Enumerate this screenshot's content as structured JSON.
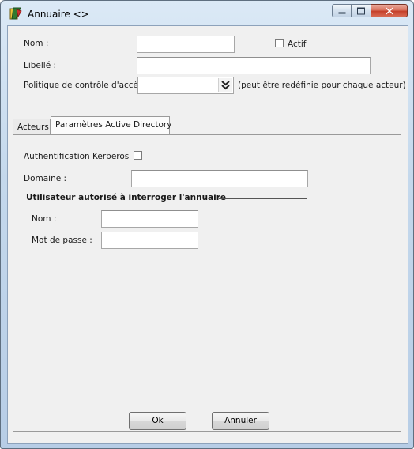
{
  "window": {
    "title": "Annuaire <>"
  },
  "form": {
    "nom_label": "Nom :",
    "nom_value": "",
    "actif_label": "Actif",
    "actif_checked": false,
    "libelle_label": "Libellé :",
    "libelle_value": "",
    "politique_label": "Politique de contrôle d'accès :",
    "politique_value": "",
    "politique_hint": "(peut être redéfinie pour chaque acteur)"
  },
  "tabs": [
    {
      "label": "Acteurs",
      "active": false
    },
    {
      "label": "Paramètres Active Directory",
      "active": true
    }
  ],
  "ad": {
    "kerberos_label": "Authentification Kerberos",
    "kerberos_checked": false,
    "domaine_label": "Domaine :",
    "domaine_value": "",
    "group_title": "Utilisateur autorisé à interroger l'annuaire",
    "user_nom_label": "Nom :",
    "user_nom_value": "",
    "password_label": "Mot de passe :",
    "password_value": ""
  },
  "buttons": {
    "ok": "Ok",
    "cancel": "Annuler"
  }
}
